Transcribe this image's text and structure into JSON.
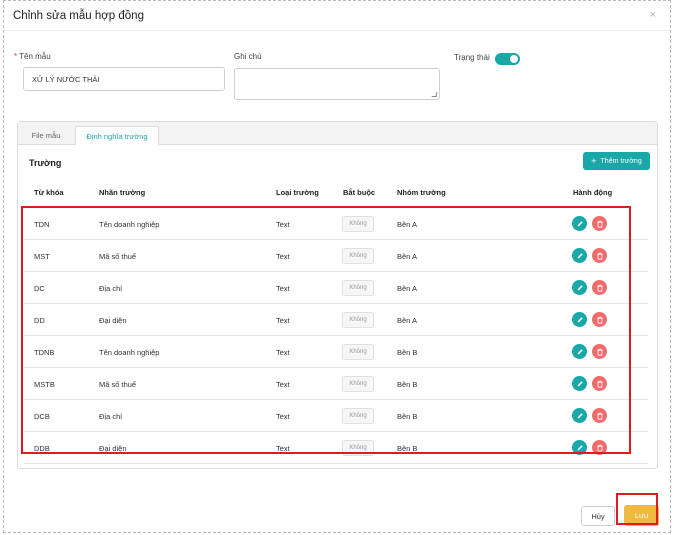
{
  "modal": {
    "title": "Chỉnh sửa mẫu hợp đồng",
    "close_icon": "×"
  },
  "form": {
    "required_mark": "*",
    "template_name_label": "Tên mẫu",
    "template_name_value": "XỬ LÝ NƯỚC THẢI",
    "note_label": "Ghi chú",
    "status_label": "Trạng thái",
    "status_on": true
  },
  "tabs": [
    {
      "label": "File mẫu",
      "active": false
    },
    {
      "label": "Định nghĩa trường",
      "active": true
    }
  ],
  "fields_section": {
    "title": "Trường",
    "add_button": {
      "icon": "plus-icon",
      "glyph": "+",
      "label": "Thêm trường"
    },
    "columns": [
      "Từ khóa",
      "Nhãn trường",
      "Loại trường",
      "Bắt buộc",
      "Nhóm trường",
      "Hành động"
    ],
    "rows": [
      {
        "key": "TDN",
        "label": "Tên doanh nghiệp",
        "type": "Text",
        "required": "Không",
        "group": "Bên A"
      },
      {
        "key": "MST",
        "label": "Mã số thuế",
        "type": "Text",
        "required": "Không",
        "group": "Bên A"
      },
      {
        "key": "DC",
        "label": "Địa chỉ",
        "type": "Text",
        "required": "Không",
        "group": "Bên A"
      },
      {
        "key": "DD",
        "label": "Đại diện",
        "type": "Text",
        "required": "Không",
        "group": "Bên A"
      },
      {
        "key": "TDNB",
        "label": "Tên doanh nghiệp",
        "type": "Text",
        "required": "Không",
        "group": "Bên B"
      },
      {
        "key": "MSTB",
        "label": "Mã số thuế",
        "type": "Text",
        "required": "Không",
        "group": "Bên B"
      },
      {
        "key": "DCB",
        "label": "Địa chỉ",
        "type": "Text",
        "required": "Không",
        "group": "Bên B"
      },
      {
        "key": "DDB",
        "label": "Đại diện",
        "type": "Text",
        "required": "Không",
        "group": "Bên B"
      }
    ]
  },
  "footer": {
    "cancel_label": "Hủy",
    "save_label": "Lưu"
  },
  "colors": {
    "accent": "#1aa7a8",
    "danger": "#ef6a6a",
    "save": "#f0b93f",
    "highlight": "#e11b1b"
  }
}
